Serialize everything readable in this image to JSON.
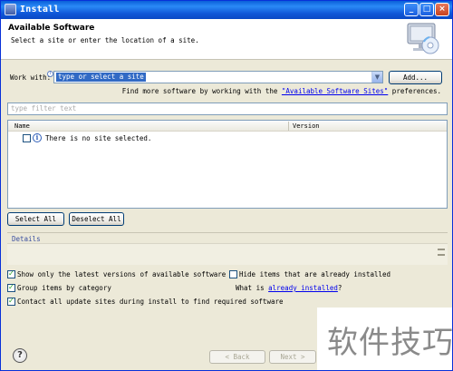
{
  "window": {
    "title": "Install"
  },
  "title_buttons": {
    "minimize": "_",
    "maximize": "□",
    "close": "×"
  },
  "header": {
    "title": "Available Software",
    "description": "Select a site or enter the location of a site."
  },
  "work_with": {
    "label": "Work with:",
    "value": "type or select a site",
    "add_button": "Add...",
    "find_more_prefix": "Find more software by working with the ",
    "find_more_link": "\"Available Software Sites\"",
    "find_more_suffix": " preferences."
  },
  "filter": {
    "placeholder": "type filter text"
  },
  "table": {
    "columns": [
      "Name",
      "Version"
    ],
    "rows": [
      {
        "text": "There is no site selected.",
        "checked": false
      }
    ]
  },
  "buttons": {
    "select_all": "Select All",
    "deselect_all": "Deselect All"
  },
  "details": {
    "label": "Details"
  },
  "options": {
    "latest_versions": {
      "label": "Show only the latest versions of available software",
      "checked": true
    },
    "hide_installed": {
      "label": "Hide items that are already installed",
      "checked": false
    },
    "group_by_category": {
      "label": "Group items by category",
      "checked": true
    },
    "what_is_prefix": "What is ",
    "already_installed_link": "already installed",
    "what_is_suffix": "?",
    "contact_all_sites": {
      "label": "Contact all update sites during install to find required software",
      "checked": true
    }
  },
  "footer": {
    "help": "?",
    "back": "< Back",
    "next": "Next >"
  },
  "watermark": {
    "text": "软件技巧"
  }
}
